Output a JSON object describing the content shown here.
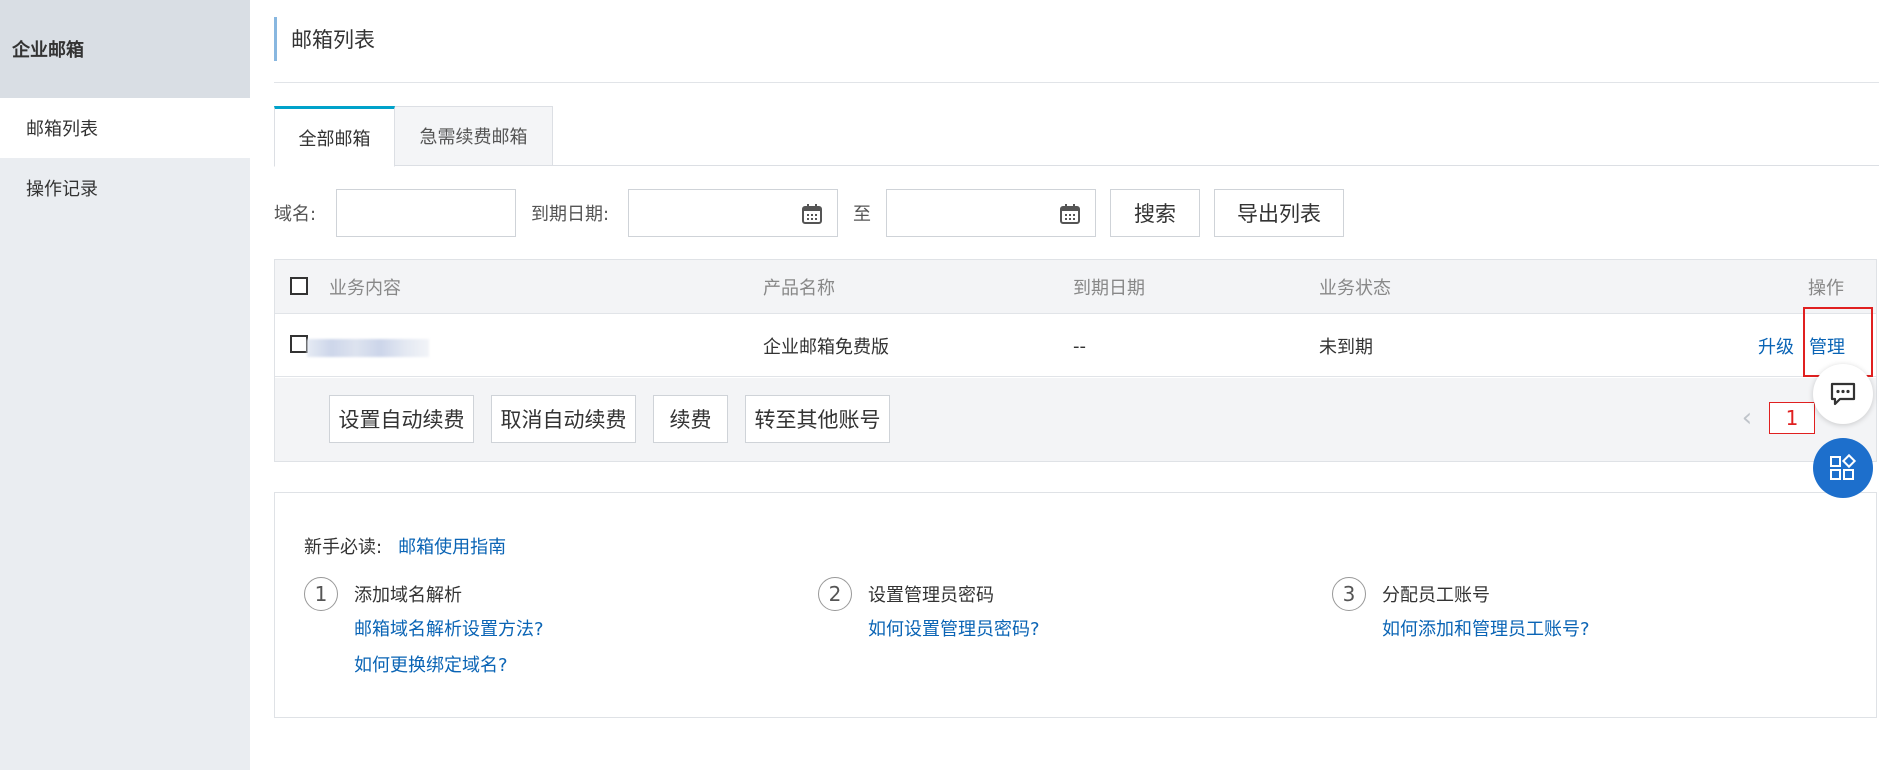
{
  "sidebar": {
    "title": "企业邮箱",
    "items": [
      {
        "label": "邮箱列表"
      },
      {
        "label": "操作记录"
      }
    ]
  },
  "page": {
    "title": "邮箱列表"
  },
  "tabs": [
    {
      "label": "全部邮箱",
      "active": true
    },
    {
      "label": "急需续费邮箱",
      "active": false
    }
  ],
  "filter": {
    "domain_label": "域名:",
    "domain_value": "",
    "expiry_label": "到期日期:",
    "expiry_from": "",
    "to_label": "至",
    "expiry_to": "",
    "search_button": "搜索",
    "export_button": "导出列表"
  },
  "table": {
    "headers": {
      "content": "业务内容",
      "product": "产品名称",
      "expiry": "到期日期",
      "status": "业务状态",
      "actions": "操作"
    },
    "rows": [
      {
        "content": "",
        "product": "企业邮箱免费版",
        "expiry": "--",
        "status": "未到期",
        "upgrade": "升级",
        "manage": "管理"
      }
    ],
    "footer_buttons": {
      "auto_renew": "设置自动续费",
      "cancel_auto_renew": "取消自动续费",
      "renew": "续费",
      "transfer": "转至其他账号"
    },
    "pager": {
      "prev": "‹",
      "current": "1"
    }
  },
  "guide": {
    "label": "新手必读:",
    "guide_link": "邮箱使用指南",
    "steps": [
      {
        "num": "1",
        "title": "添加域名解析",
        "links": [
          "邮箱域名解析设置方法?",
          "如何更换绑定域名?"
        ]
      },
      {
        "num": "2",
        "title": "设置管理员密码",
        "links": [
          "如何设置管理员密码?"
        ]
      },
      {
        "num": "3",
        "title": "分配员工账号",
        "links": [
          "如何添加和管理员工账号?"
        ]
      }
    ]
  },
  "colors": {
    "link": "#0a64b5",
    "accent_tab": "#00a2ca",
    "highlight": "#e02020",
    "float_button": "#1d6fcc"
  },
  "icons": [
    "calendar-icon",
    "chat-icon",
    "apps-icon",
    "chevron-left-icon"
  ]
}
